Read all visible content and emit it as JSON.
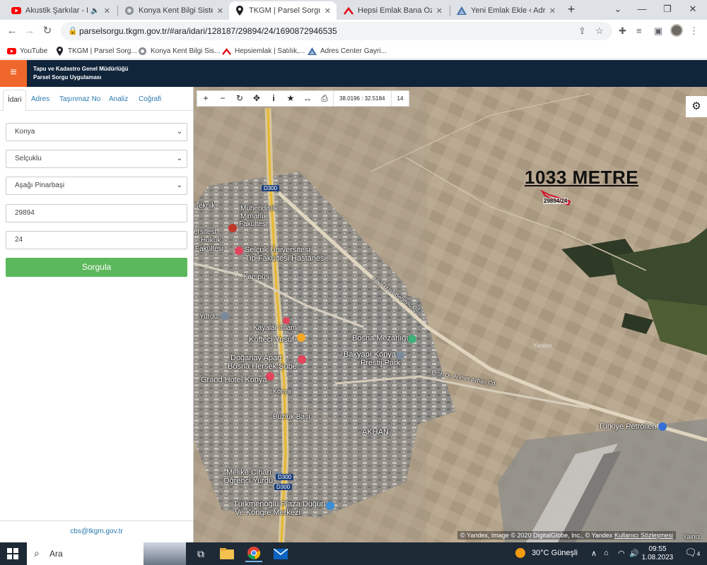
{
  "browser": {
    "tabs": [
      {
        "title": "Akustik Şarkılar - En Ç",
        "icon": "youtube-icon",
        "color": "#ff0000",
        "active": false
      },
      {
        "title": "Konya Kent Bilgi Sistemi",
        "icon": "kent-icon",
        "color": "#5f6368",
        "active": false
      },
      {
        "title": "TKGM | Parsel Sorgu Uyg",
        "icon": "location-pin-icon",
        "color": "#202124",
        "active": true
      },
      {
        "title": "Hepsi Emlak Bana Özel",
        "icon": "hepsiemlak-icon",
        "color": "#e30613",
        "active": false
      },
      {
        "title": "Yeni Emlak Ekle ‹ Adres C",
        "icon": "adres-icon",
        "color": "#3f6ea5",
        "active": false
      }
    ],
    "url": "parselsorgu.tkgm.gov.tr/#ara/idari/128187/29894/24/1690872946535",
    "bookmarks": [
      {
        "label": "YouTube",
        "icon": "youtube-icon"
      },
      {
        "label": "TKGM | Parsel Sorg...",
        "icon": "location-pin-icon"
      },
      {
        "label": "Konya Kent Bilgi Sis...",
        "icon": "kent-icon"
      },
      {
        "label": "Hepsiemlak | Satılık,...",
        "icon": "hepsiemlak-icon"
      },
      {
        "label": "Adres Center Gayri...",
        "icon": "adres-icon"
      }
    ]
  },
  "app": {
    "title_line1": "Tapu ve Kadastro Genel Müdürlüğü",
    "title_line2": "Parsel Sorgu Uygulaması",
    "accent_color": "#f0672b",
    "header_color": "#10243a"
  },
  "panel": {
    "tabs": [
      "İdari",
      "Adres",
      "Taşınmaz No",
      "Analiz",
      "Coğrafi"
    ],
    "active_tab": "İdari",
    "province": "Konya",
    "district": "Selçuklu",
    "neighborhood": "Aşağı Pinarbaşi",
    "block_no": "29894",
    "parcel_no": "24",
    "submit_label": "Sorgula",
    "submit_color": "#5cb85c",
    "footer_email": "cbs@tkgm.gov.tr"
  },
  "map": {
    "toolbar_icons": [
      "zoom-in-icon",
      "zoom-out-icon",
      "refresh-icon",
      "locate-icon",
      "info-icon",
      "star-icon",
      "measure-icon",
      "print-icon"
    ],
    "coordinates": "38.0196 : 32.5184",
    "zoom_level": "14",
    "annotation": "1033 METRE",
    "parcel_label": "29894/24",
    "watermark": "Yandex",
    "labels": [
      {
        "text": "Selçuk Üniversitesi",
        "kind": "big"
      },
      {
        "text": "Tıp Fakültesi Hastanesi",
        "kind": "big"
      },
      {
        "text": "Mühendislik",
        "kind": "normal"
      },
      {
        "text": "Mimarlık",
        "kind": "normal"
      },
      {
        "text": "Fakültesi",
        "kind": "normal"
      },
      {
        "text": "Teknik",
        "kind": "normal"
      },
      {
        "text": "ersitesi",
        "kind": "normal"
      },
      {
        "text": "Hukuk",
        "kind": "normal"
      },
      {
        "text": "Fakültesi",
        "kind": "normal"
      },
      {
        "text": "Kampüs",
        "kind": "normal"
      },
      {
        "text": "Yurdu",
        "kind": "normal"
      },
      {
        "text": "Kayalar İmam",
        "kind": "normal"
      },
      {
        "text": "Köfteci Yusuf",
        "kind": "big"
      },
      {
        "text": "Doğanay Apart",
        "kind": "big"
      },
      {
        "text": "Bosna Hersek Şube",
        "kind": "big"
      },
      {
        "text": "Grand Hotel Konya",
        "kind": "big"
      },
      {
        "text": "Bosna Mezarlığı",
        "kind": "big"
      },
      {
        "text": "Bakyapı Konya",
        "kind": "big"
      },
      {
        "text": "Prestij Park",
        "kind": "big"
      },
      {
        "text": "AKHAN",
        "kind": "big"
      },
      {
        "text": "Buzluk Başı",
        "kind": "normal"
      },
      {
        "text": "Melike Cihan",
        "kind": "big"
      },
      {
        "text": "Öğrenci Yurdu",
        "kind": "big"
      },
      {
        "text": "Türkmenoğlu Plaza Düğün",
        "kind": "big"
      },
      {
        "text": "Ve Kongre Merkezi",
        "kind": "big"
      },
      {
        "text": "Türkiye Petrolleri",
        "kind": "big"
      },
      {
        "text": "Aliya İzzet Begoviç Cd.",
        "kind": "normal"
      },
      {
        "text": "Prof. Dr. Ahmet Ayhan Cd.",
        "kind": "normal"
      },
      {
        "text": "Konya",
        "kind": "normal"
      },
      {
        "text": "Yalnız",
        "kind": "normal"
      }
    ],
    "road_shields": [
      "D300",
      "D300",
      "D300"
    ],
    "copyright_prefix": "© Yandex, Image © 2020 DigitalGlobe, Inc., © Yandex",
    "copyright_link": "Kullanıcı Sözleşmesi"
  },
  "taskbar": {
    "search_placeholder": "Ara",
    "weather": "30°C  Güneşli",
    "time": "09:55",
    "date": "1.08.2023",
    "notification_count": "4"
  }
}
